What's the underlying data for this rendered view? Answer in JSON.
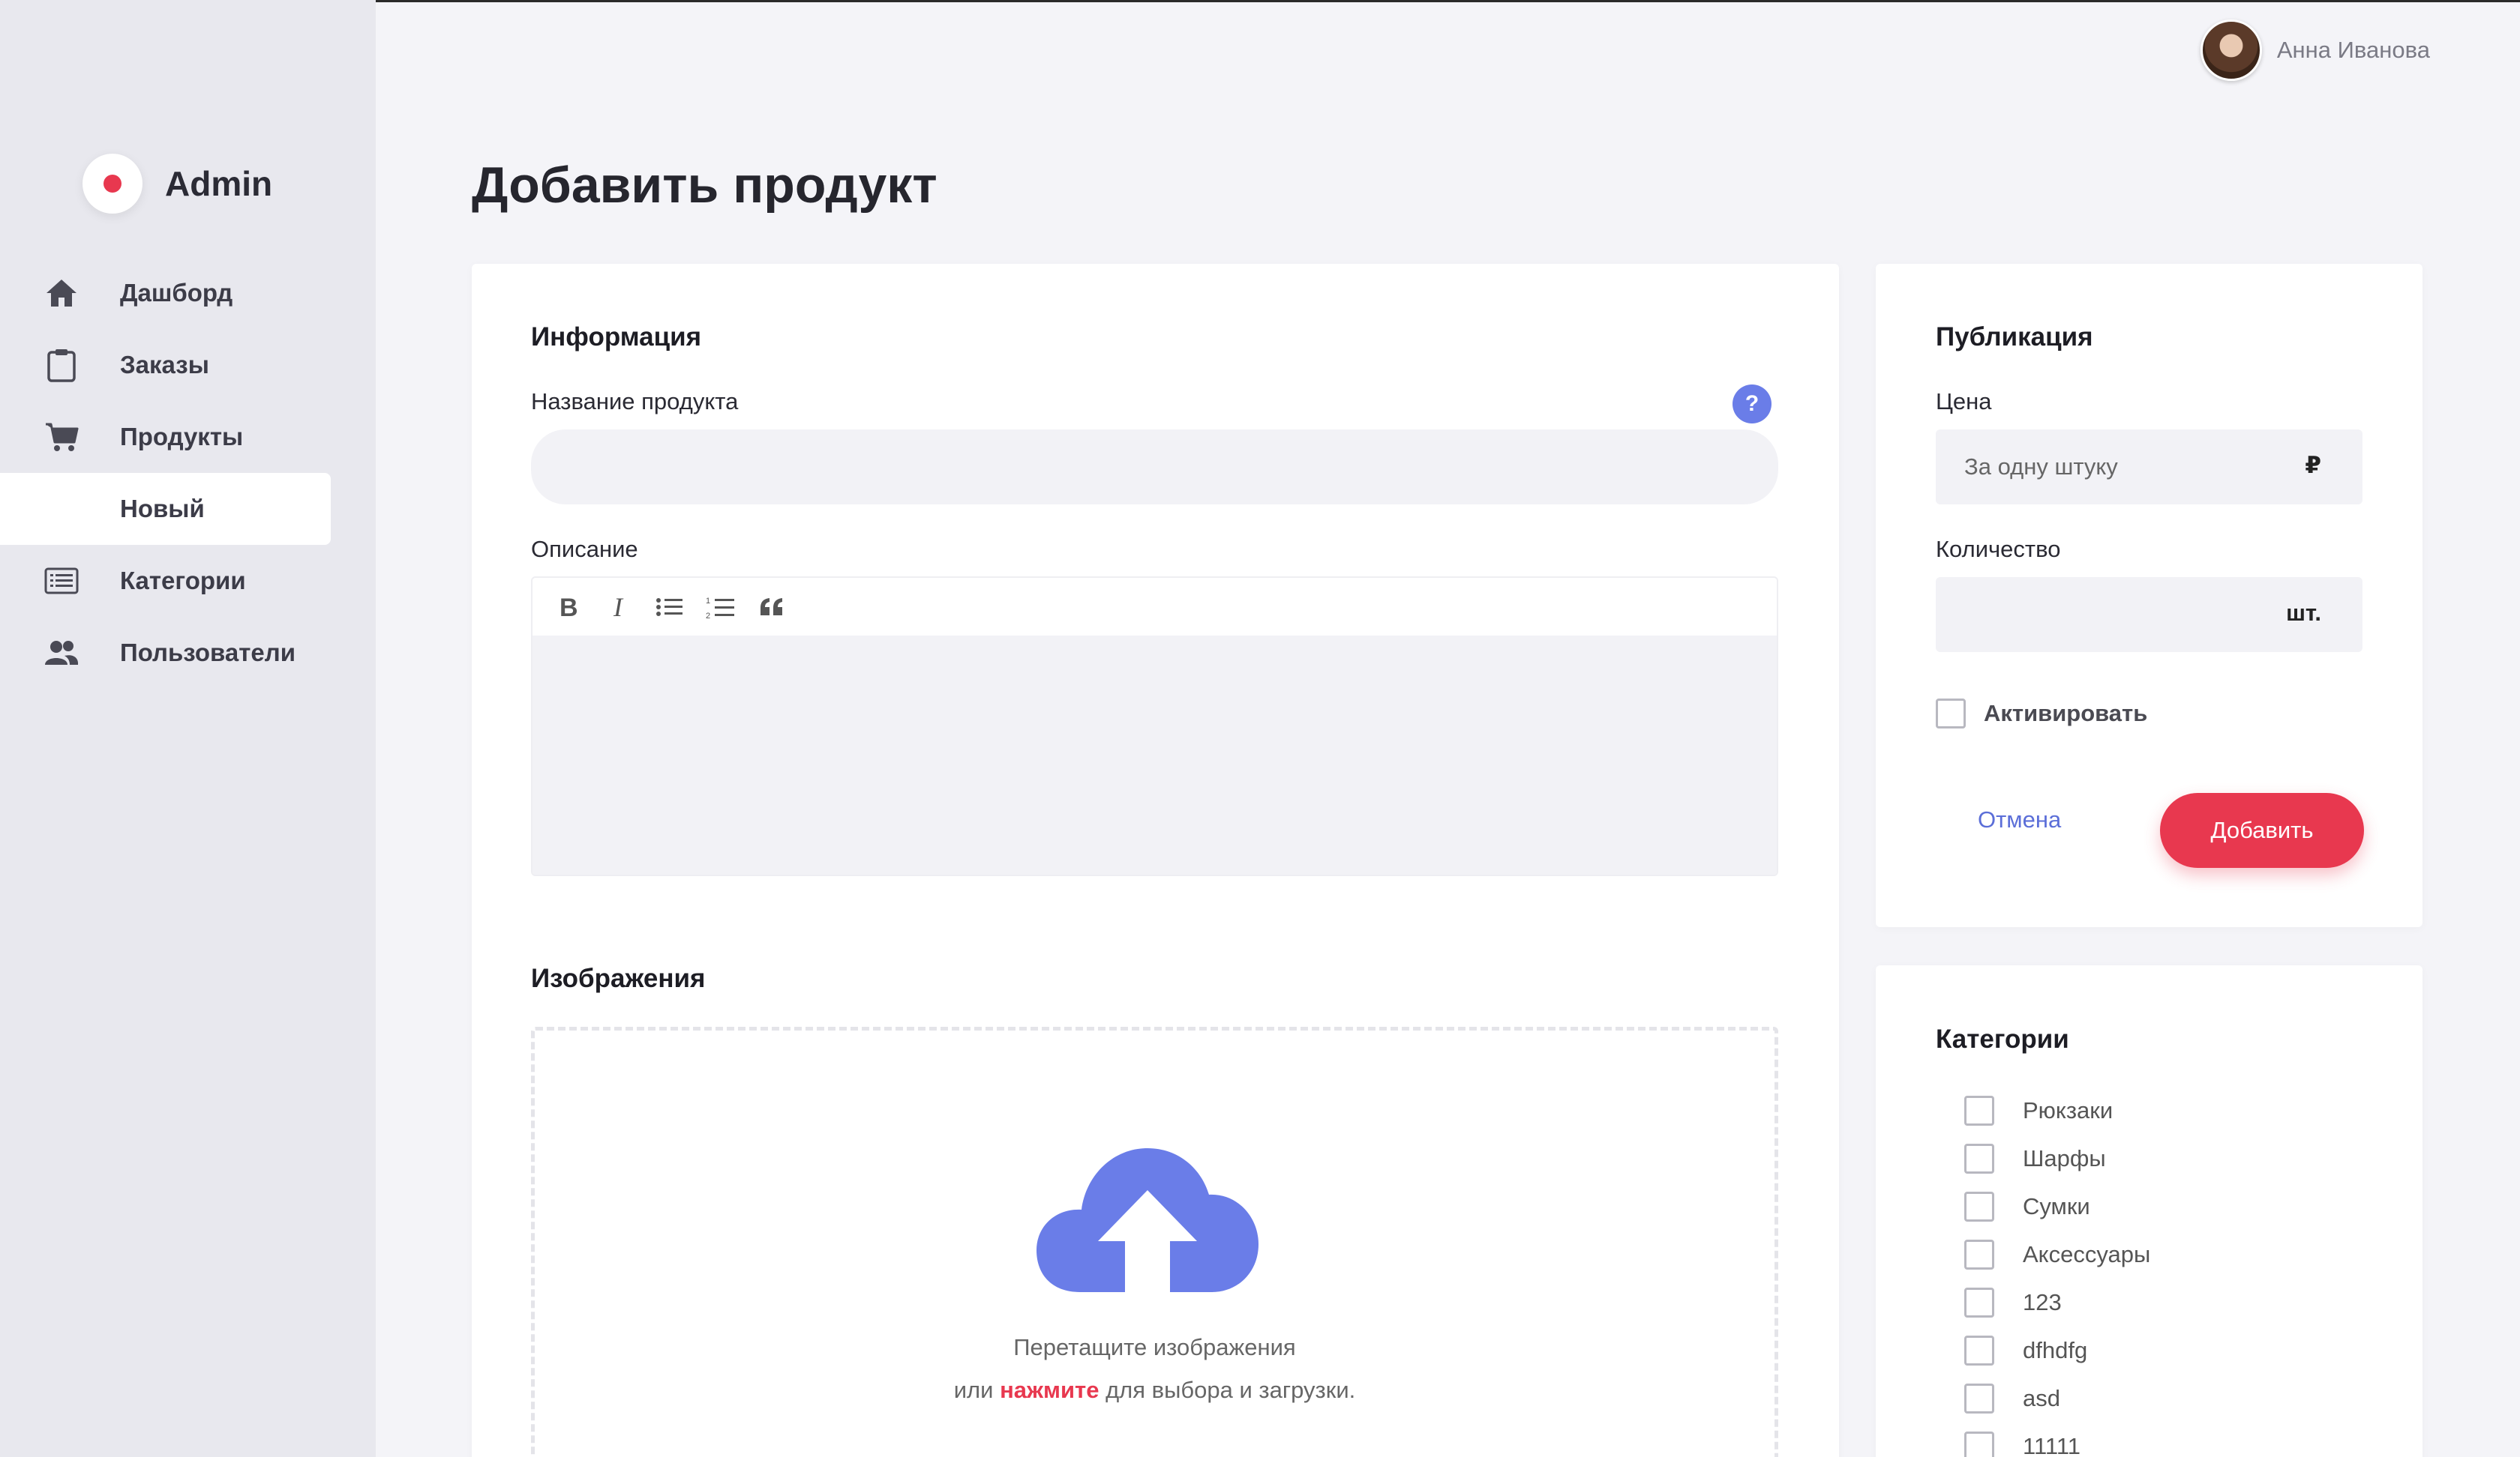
{
  "app": {
    "title": "Admin"
  },
  "user": {
    "name": "Анна Иванова"
  },
  "sidebar": {
    "items": [
      {
        "label": "Дашборд",
        "icon": "home-icon"
      },
      {
        "label": "Заказы",
        "icon": "clipboard-icon"
      },
      {
        "label": "Продукты",
        "icon": "cart-icon"
      },
      {
        "label": "Новый",
        "icon": "",
        "active": true
      },
      {
        "label": "Категории",
        "icon": "list-icon"
      },
      {
        "label": "Пользователи",
        "icon": "users-icon"
      }
    ]
  },
  "page": {
    "title": "Добавить продукт"
  },
  "info": {
    "title": "Информация",
    "name_label": "Название продукта",
    "name_value": "",
    "help": "?",
    "description_label": "Описание",
    "toolbar": [
      "bold-icon",
      "italic-icon",
      "bullet-list-icon",
      "numbered-list-icon",
      "quote-icon"
    ]
  },
  "images": {
    "title": "Изображения",
    "drop_line1": "Перетащите изображения",
    "drop_prefix": "или",
    "drop_link": "нажмите",
    "drop_suffix": "для выбора и загрузки."
  },
  "publication": {
    "title": "Публикация",
    "price_label": "Цена",
    "price_placeholder": "За одну штуку",
    "price_unit": "₽",
    "quantity_label": "Количество",
    "quantity_unit": "шт.",
    "activate_label": "Активировать",
    "cancel_label": "Отмена",
    "add_label": "Добавить"
  },
  "categories": {
    "title": "Категории",
    "items": [
      "Рюкзаки",
      "Шарфы",
      "Сумки",
      "Аксессуары",
      "123",
      "dfhdfg",
      "asd",
      "11111"
    ]
  },
  "colors": {
    "accent": "#e8384f",
    "primary": "#6a7de8",
    "sidebar_bg": "#e8e8ee",
    "page_bg": "#f4f4f8"
  }
}
